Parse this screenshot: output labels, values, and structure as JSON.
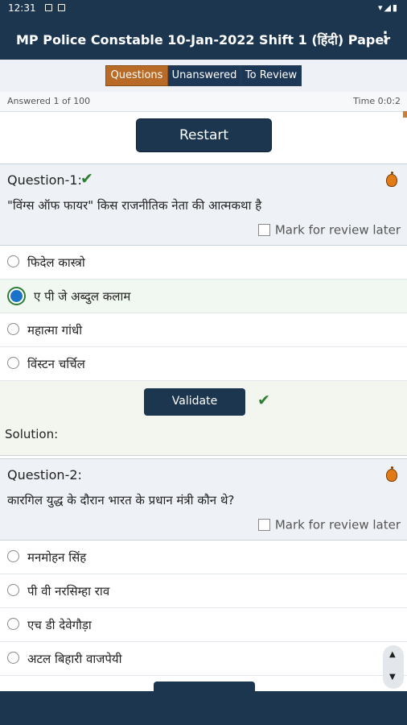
{
  "status_bar": {
    "time": "12:31",
    "right_icons": "▾◢▮"
  },
  "app_bar": {
    "title": "MP Police Constable 10-Jan-2022 Shift 1 (हिंदी) Paper",
    "menu_icon": "⋮"
  },
  "tabs": [
    {
      "label": "Questions",
      "active": true
    },
    {
      "label": "Unanswered",
      "active": false
    },
    {
      "label": "To Review",
      "active": false
    }
  ],
  "stats": {
    "answered": "Answered 1 of 100",
    "time": "Time 0:0:2"
  },
  "restart_label": "Restart",
  "review_label": "Mark for review later",
  "validate_label": "Validate",
  "solution_label": "Solution:",
  "questions": [
    {
      "title": "Question-1:",
      "correct_mark": "✔",
      "text": "\"विंग्स ऑफ फायर\" किस राजनीतिक नेता की आत्मकथा है",
      "options": [
        "फिदेल कास्त्रो",
        "ए पी जे अब्दुल कलाम",
        "महात्मा गांधी",
        "विंस्टन चर्चिल"
      ],
      "selected_index": 1,
      "validated_mark": "✔"
    },
    {
      "title": "Question-2:",
      "text": "कारगिल युद्ध के दौरान भारत के प्रधान मंत्री कौन थे?",
      "options": [
        "मनमोहन सिंह",
        "पी वी नरसिम्हा राव",
        "एच डी देवेगौड़ा",
        "अटल बिहारी वाजपेयी"
      ],
      "selected_index": null
    }
  ],
  "scroll_control": {
    "up_icon": "▲",
    "down_icon": "▼"
  },
  "colors": {
    "primary": "#1c3650",
    "active_tab": "#b86a27",
    "check": "#2e7d32",
    "radio_selected": "#1a73c8"
  }
}
